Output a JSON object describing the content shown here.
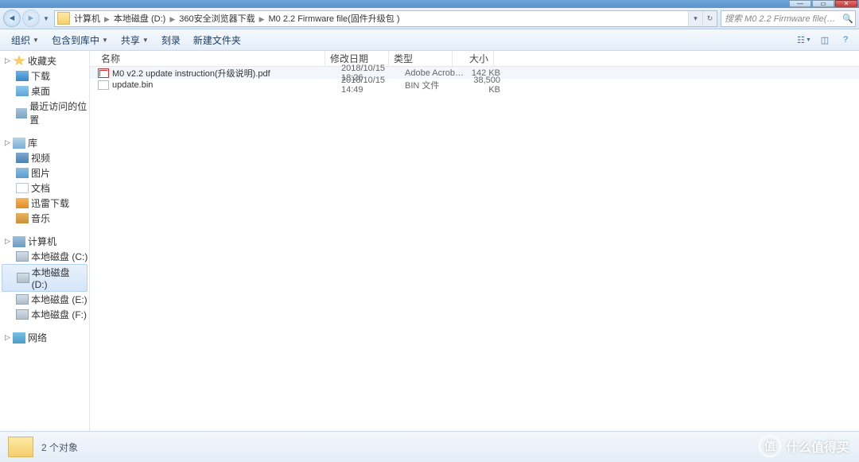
{
  "breadcrumb": [
    "计算机",
    "本地磁盘 (D:)",
    "360安全浏览器下载",
    "M0 2.2 Firmware file(固件升级包 )"
  ],
  "search_placeholder": "搜索 M0 2.2 Firmware file(固件升级...",
  "toolbar": {
    "organize": "组织",
    "include": "包含到库中",
    "share": "共享",
    "burn": "刻录",
    "newfolder": "新建文件夹"
  },
  "tree": {
    "favorites": "收藏夹",
    "downloads": "下载",
    "desktop": "桌面",
    "recent": "最近访问的位置",
    "libraries": "库",
    "videos": "视频",
    "pictures": "图片",
    "documents": "文档",
    "thunder": "迅雷下载",
    "music": "音乐",
    "computer": "计算机",
    "drive_c": "本地磁盘 (C:)",
    "drive_d": "本地磁盘 (D:)",
    "drive_e": "本地磁盘 (E:)",
    "drive_f": "本地磁盘 (F:)",
    "network": "网络"
  },
  "columns": {
    "name": "名称",
    "date": "修改日期",
    "type": "类型",
    "size": "大小"
  },
  "files": [
    {
      "name": "M0 v2.2 update instruction(升级说明).pdf",
      "date": "2018/10/15 18:26",
      "type": "Adobe Acrobat ...",
      "size": "142 KB",
      "icon": "ic-pdf"
    },
    {
      "name": "update.bin",
      "date": "2018/10/15 14:49",
      "type": "BIN 文件",
      "size": "38,500 KB",
      "icon": "ic-bin"
    }
  ],
  "status": "2 个对象",
  "watermark": {
    "badge": "值",
    "text": "什么值得买"
  }
}
